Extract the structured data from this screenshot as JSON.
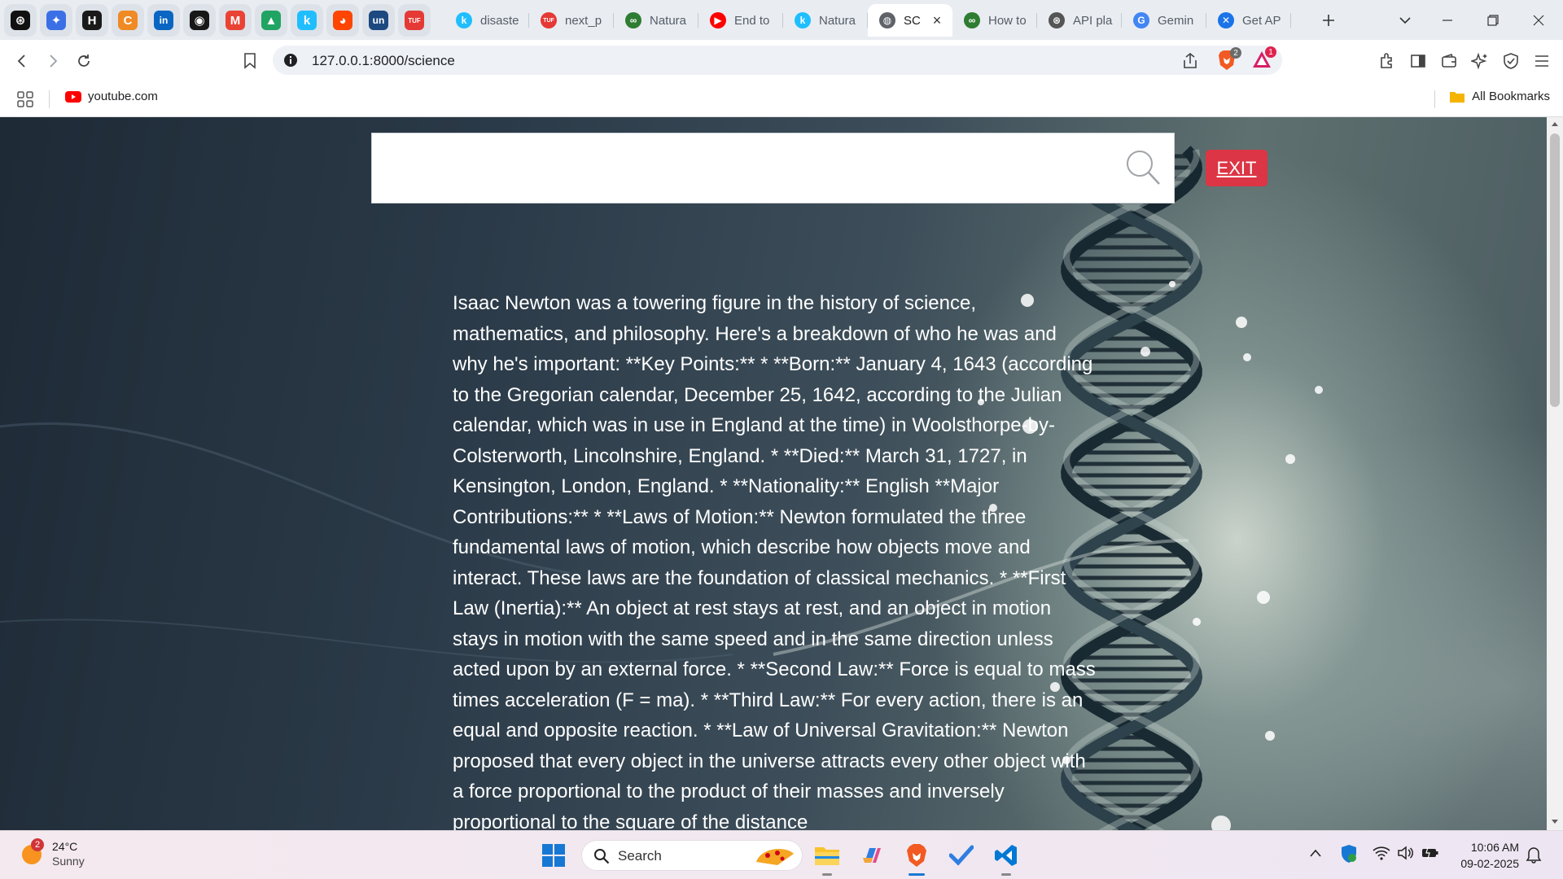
{
  "browser": {
    "pinned_tabs": [
      {
        "icon": "openai-icon",
        "glyph": "⊛",
        "color": "#111111"
      },
      {
        "icon": "gemini-icon",
        "glyph": "✦",
        "color": "#3b6fe6"
      },
      {
        "icon": "hackerrank-icon",
        "glyph": "H",
        "color": "#1a1a1a"
      },
      {
        "icon": "c-icon",
        "glyph": "C",
        "color": "#f08a24"
      },
      {
        "icon": "linkedin-icon",
        "glyph": "in",
        "color": "#0a66c2"
      },
      {
        "icon": "github-icon",
        "glyph": "◉",
        "color": "#181717"
      },
      {
        "icon": "gmail-icon",
        "glyph": "M",
        "color": "#ea4335"
      },
      {
        "icon": "google-drive-icon",
        "glyph": "▲",
        "color": "#1fa463"
      },
      {
        "icon": "kaggle-icon",
        "glyph": "k",
        "color": "#20beff"
      },
      {
        "icon": "reddit-icon",
        "glyph": "◕",
        "color": "#ff4500"
      },
      {
        "icon": "unstop-icon",
        "glyph": "un",
        "color": "#1c4980"
      },
      {
        "icon": "tufts-icon",
        "glyph": "TUF",
        "color": "#e53935"
      }
    ],
    "tabs": [
      {
        "title": "disaste",
        "icon": "kaggle-icon",
        "favicon": "k",
        "color": "#20beff"
      },
      {
        "title": "next_p",
        "icon": "tuf-icon",
        "favicon": "TUF",
        "color": "#e53935"
      },
      {
        "title": "Natura",
        "icon": "huggingface-icon",
        "favicon": "∞",
        "color": "#2e7d32"
      },
      {
        "title": "End to",
        "icon": "youtube-icon",
        "favicon": "▶",
        "color": "#ff0000"
      },
      {
        "title": "Natura",
        "icon": "kaggle-icon",
        "favicon": "k",
        "color": "#20beff"
      },
      {
        "title": "SC",
        "icon": "globe-icon",
        "favicon": "◍",
        "color": "#5f6368",
        "active": true
      },
      {
        "title": "How to",
        "icon": "huggingface-icon",
        "favicon": "∞",
        "color": "#2e7d32"
      },
      {
        "title": "API pla",
        "icon": "openai-icon",
        "favicon": "⊛",
        "color": "#555555"
      },
      {
        "title": "Gemin",
        "icon": "google-icon",
        "favicon": "G",
        "color": "#4285f4"
      },
      {
        "title": "Get AP",
        "icon": "google-ai-studio-icon",
        "favicon": "✕",
        "color": "#1a73e8"
      }
    ],
    "url": "127.0.0.1:8000/science",
    "brave_badge": "2",
    "rewards_badge": "1",
    "bookmarks": {
      "youtube": "youtube.com",
      "all": "All Bookmarks"
    }
  },
  "page": {
    "search_placeholder": "",
    "exit_label": "EXIT",
    "answer_text": "Isaac Newton was a towering figure in the history of science, mathematics, and philosophy. Here's a breakdown of who he was and why he's important: **Key Points:** * **Born:** January 4, 1643 (according to the Gregorian calendar, December 25, 1642, according to the Julian calendar, which was in use in England at the time) in Woolsthorpe-by-Colsterworth, Lincolnshire, England. * **Died:** March 31, 1727, in Kensington, London, England. * **Nationality:** English **Major Contributions:** * **Laws of Motion:** Newton formulated the three fundamental laws of motion, which describe how objects move and interact. These laws are the foundation of classical mechanics. * **First Law (Inertia):** An object at rest stays at rest, and an object in motion stays in motion with the same speed and in the same direction unless acted upon by an external force. * **Second Law:** Force is equal to mass times acceleration (F = ma). * **Third Law:** For every action, there is an equal and opposite reaction. * **Law of Universal Gravitation:** Newton proposed that every object in the universe attracts every other object with a force proportional to the product of their masses and inversely proportional to the square of the distance"
  },
  "taskbar": {
    "weather_temp": "24°C",
    "weather_desc": "Sunny",
    "weather_badge": "2",
    "search_label": "Search",
    "time": "10:06 AM",
    "date": "09-02-2025"
  },
  "colors": {
    "exit_bg": "#dc3545",
    "accent": "#1a73e8"
  }
}
